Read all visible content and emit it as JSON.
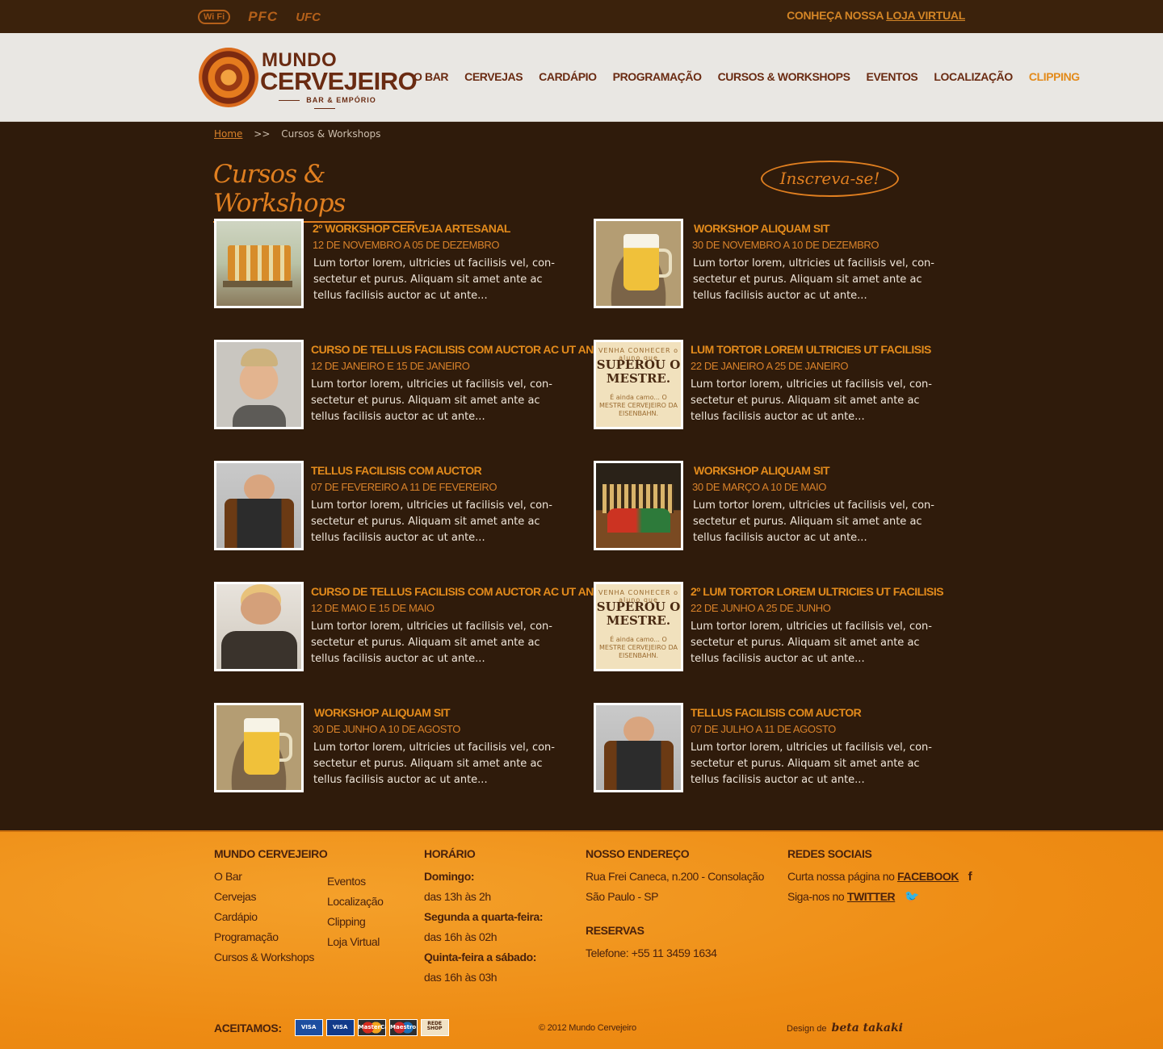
{
  "topbar": {
    "badges": [
      "Wi Fi",
      "PFC",
      "UFC"
    ],
    "store_prefix": "CONHEÇA NOSSA",
    "store_link": "LOJA VIRTUAL"
  },
  "logo": {
    "line1": "MUNDO",
    "line2": "CERVEJEIRO",
    "sub": "BAR & EMPÓRIO"
  },
  "nav": [
    {
      "label": "O BAR"
    },
    {
      "label": "CERVEJAS"
    },
    {
      "label": "CARDÁPIO"
    },
    {
      "label": "PROGRAMAÇÃO"
    },
    {
      "label": "CURSOS & WORKSHOPS"
    },
    {
      "label": "EVENTOS"
    },
    {
      "label": "LOCALIZAÇÃO"
    },
    {
      "label": "CLIPPING",
      "active": true
    }
  ],
  "breadcrumb": {
    "home": "Home",
    "sep": ">>",
    "current": "Cursos & Workshops"
  },
  "page": {
    "title": "Cursos & Workshops",
    "signup": "Inscreva-se!"
  },
  "description_lines": [
    "Lum tortor lorem, ultricies ut facilisis vel, con-",
    "sectetur et purus. Aliquam sit amet ante ac",
    "tellus facilisis auctor ac ut ante..."
  ],
  "courses": [
    {
      "title": "2º WORKSHOP CERVEJA ARTESANAL",
      "date": "12 DE NOVEMBRO A 05 DE DEZEMBRO",
      "image": "steampunk"
    },
    {
      "title": "WORKSHOP ALIQUAM SIT",
      "date": "30 DE NOVEMBRO A 10 DE DEZEMBRO",
      "image": "beer"
    },
    {
      "title": "CURSO DE TELLUS FACILISIS COM AUCTOR AC UT ANTE",
      "date": "12 DE JANEIRO E 15 DE JANEIRO",
      "image": "face"
    },
    {
      "title": "LUM TORTOR LOREM ULTRICIES UT FACILISIS",
      "date": "22 DE JANEIRO A 25 DE JANEIRO",
      "image": "poster"
    },
    {
      "title": "TELLUS FACILISIS COM AUCTOR",
      "date": "07 DE FEVEREIRO A 11 DE FEVEREIRO",
      "image": "bottles"
    },
    {
      "title": "WORKSHOP ALIQUAM SIT",
      "date": "30 DE MARÇO A 10 DE MAIO",
      "image": "bar"
    },
    {
      "title": "CURSO DE TELLUS FACILISIS COM AUCTOR AC UT ANTE",
      "date": "12 DE MAIO E 15 DE MAIO",
      "image": "drink"
    },
    {
      "title": "2º LUM TORTOR LOREM ULTRICIES UT FACILISIS",
      "date": "22 DE JUNHO A 25 DE JUNHO",
      "image": "poster"
    },
    {
      "title": "WORKSHOP ALIQUAM SIT",
      "date": "30 DE JUNHO A 10 DE AGOSTO",
      "image": "beer"
    },
    {
      "title": "TELLUS FACILISIS COM AUCTOR",
      "date": "07 DE JULHO A 11 DE AGOSTO",
      "image": "bottles"
    }
  ],
  "poster": {
    "top": "VENHA CONHECER o aluno que",
    "main": "SUPEROU O MESTRE.",
    "bottom": "É ainda camo... O MESTRE CERVEJEIRO DA EISENBAHN."
  },
  "footer": {
    "col1_title": "MUNDO CERVEJEIRO",
    "links_a": [
      "O Bar",
      "Cervejas",
      "Cardápio",
      "Programação",
      "Cursos & Workshops"
    ],
    "links_b": [
      "Eventos",
      "Localização",
      "Clipping",
      "Loja Virtual"
    ],
    "hours_title": "HORÁRIO",
    "hours": [
      {
        "day": "Domingo:",
        "time": "das 13h às 2h"
      },
      {
        "day": "Segunda a quarta-feira:",
        "time": "das 16h às 02h"
      },
      {
        "day": "Quinta-feira a sábado:",
        "time": "das 16h às 03h"
      }
    ],
    "address_title": "NOSSO ENDEREÇO",
    "address_line1": "Rua Frei Caneca, n.200 - Consolação",
    "address_line2": "São Paulo - SP",
    "reservations_title": "RESERVAS",
    "phone": "Telefone: +55 11 3459 1634",
    "social_title": "REDES SOCIAIS",
    "facebook_prefix": "Curta nossa página no",
    "facebook_link": "FACEBOOK",
    "twitter_prefix": "Siga-nos no",
    "twitter_link": "TWITTER",
    "accept_label": "ACEITAMOS:",
    "cards": [
      "VISA",
      "VISA Electron",
      "MasterCard",
      "Maestro",
      "REDE SHOP"
    ],
    "copyright": "© 2012 Mundo Cervejeiro",
    "design_prefix": "Design de",
    "designer": "beta takaki"
  }
}
